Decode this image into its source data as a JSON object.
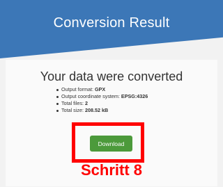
{
  "header": {
    "title": "Conversion Result"
  },
  "result": {
    "heading": "Your data were converted",
    "details": [
      {
        "label": "Output format:",
        "value": "GPX"
      },
      {
        "label": "Output coordinate system:",
        "value": "EPSG:4326"
      },
      {
        "label": "Total files:",
        "value": "2"
      },
      {
        "label": "Total size:",
        "value": "208.52 kB"
      }
    ],
    "download_label": "Download"
  },
  "annotation": {
    "step_label": "Schritt 8",
    "highlight_color": "#ff0000"
  },
  "colors": {
    "header_blue": "#3c77b7",
    "button_green": "#4c9a3b"
  }
}
